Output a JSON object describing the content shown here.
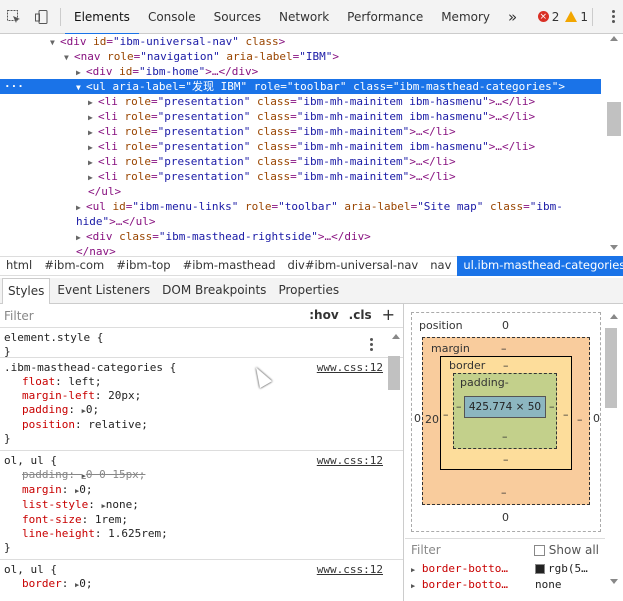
{
  "toolbar": {
    "tabs": [
      "Elements",
      "Console",
      "Sources",
      "Network",
      "Performance",
      "Memory"
    ],
    "more": "»",
    "errors": "2",
    "warnings": "1"
  },
  "tree": {
    "l1": {
      "open": "<div ",
      "an1": "id",
      "av1": "\"ibm-universal-nav\"",
      "an2": " class",
      "close": ">"
    },
    "l2": {
      "open": "<nav ",
      "an1": "role",
      "av1": "\"navigation\"",
      "an2": " aria-label",
      "av2": "\"IBM\"",
      "close": ">"
    },
    "l3": {
      "open": "<div ",
      "an1": "id",
      "av1": "\"ibm-home\"",
      "mid": ">…</",
      "close": "div>"
    },
    "l4": {
      "open": "<ul ",
      "an1": "aria-label",
      "av1": "\"发现 IBM\"",
      "an2": " role",
      "av2": "\"toolbar\"",
      "an3": " class",
      "av3": "\"ibm-masthead-categories\"",
      "close": ">"
    },
    "li": [
      {
        "cls": "\"ibm-mh-mainitem ibm-hasmenu\""
      },
      {
        "cls": "\"ibm-mh-mainitem ibm-hasmenu\""
      },
      {
        "cls": "\"ibm-mh-mainitem\""
      },
      {
        "cls": "\"ibm-mh-mainitem ibm-hasmenu\""
      },
      {
        "cls": "\"ibm-mh-mainitem\""
      },
      {
        "cls": "\"ibm-mh-mainitem\""
      }
    ],
    "li_open": "<li ",
    "li_role": "role",
    "li_roleval": "\"presentation\"",
    "li_class": " class",
    "li_close": ">…</li>",
    "ul_close": "</ul>",
    "l5": {
      "open": "<ul ",
      "an1": "id",
      "av1": "\"ibm-menu-links\"",
      "an2": " role",
      "av2": "\"toolbar\"",
      "an3": " aria-label",
      "av3": "\"Site map\"",
      "an4": " class",
      "av4": "\"ibm-",
      "close": ""
    },
    "l5b": {
      "av": "hide\"",
      "close": ">…</ul>"
    },
    "l6": {
      "open": "<div ",
      "an1": "class",
      "av1": "\"ibm-masthead-rightside\"",
      "close": ">…</div>"
    },
    "nav_close": "</nav>"
  },
  "breadcrumbs": [
    "html",
    "#ibm-com",
    "#ibm-top",
    "#ibm-masthead",
    "div#ibm-universal-nav",
    "nav",
    "ul.ibm-masthead-categories"
  ],
  "subtabs": [
    "Styles",
    "Event Listeners",
    "DOM Breakpoints",
    "Properties"
  ],
  "styles": {
    "filter_placeholder": "Filter",
    "hov": ":hov",
    "cls": ".cls",
    "plus": "+",
    "rules": [
      {
        "selector": "element.style {",
        "source": "",
        "props": [],
        "close": "}"
      },
      {
        "selector": ".ibm-masthead-categories {",
        "source": "www.css:12",
        "props": [
          {
            "n": "float",
            "v": "left;",
            "tri": false,
            "strike": false
          },
          {
            "n": "margin-left",
            "v": "20px;",
            "tri": false,
            "strike": false
          },
          {
            "n": "padding",
            "v": "0;",
            "tri": true,
            "strike": false
          },
          {
            "n": "position",
            "v": "relative;",
            "tri": false,
            "strike": false
          }
        ],
        "close": "}"
      },
      {
        "selector": "ol, ul {",
        "source": "www.css:12",
        "props": [
          {
            "n": "padding",
            "v": "0 0 15px;",
            "tri": true,
            "strike": true
          },
          {
            "n": "margin",
            "v": "0;",
            "tri": true,
            "strike": false
          },
          {
            "n": "list-style",
            "v": "none;",
            "tri": true,
            "strike": false
          },
          {
            "n": "font-size",
            "v": "1rem;",
            "tri": false,
            "strike": false
          },
          {
            "n": "line-height",
            "v": "1.625rem;",
            "tri": false,
            "strike": false
          }
        ],
        "close": "}"
      },
      {
        "selector": "ol, ul {",
        "source": "www.css:12",
        "props": [
          {
            "n": "border",
            "v": "0;",
            "tri": true,
            "strike": false
          }
        ],
        "close": ""
      }
    ]
  },
  "boxmodel": {
    "position_label": "position",
    "position_val": "0",
    "margin_label": "margin",
    "margin_top": "–",
    "margin_bottom": "–",
    "margin_left": "20",
    "margin_right": "–",
    "outer_left": "0",
    "outer_right": "0",
    "outer_bottom": "0",
    "border_label": "border",
    "border_top": "–",
    "border_bottom": "–",
    "border_left": "–",
    "border_right": "–",
    "padding_label": "padding-",
    "padding_bottom": "–",
    "padding_left": "–",
    "padding_right": "–",
    "content": "425.774 × 50"
  },
  "computed": {
    "filter_placeholder": "Filter",
    "show_all": "Show all",
    "rows": [
      {
        "n": "border-botto…",
        "v": "rgb(5…",
        "swatch": true
      },
      {
        "n": "border-botto…",
        "v": "none",
        "swatch": false
      }
    ]
  },
  "colors": {
    "accent": "#1a73e8",
    "margin": "#f9cc9d",
    "border": "#fddd9b",
    "padding": "#c3d08b",
    "content": "#8cb6c0"
  }
}
